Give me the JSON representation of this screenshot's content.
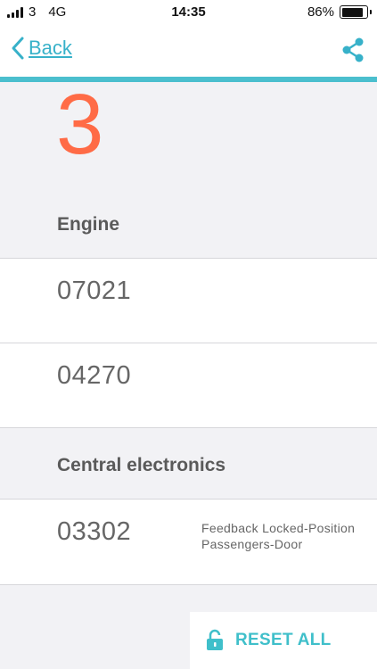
{
  "status_bar": {
    "carrier": "3",
    "network": "4G",
    "time": "14:35",
    "battery": "86%",
    "battery_level": 0.86
  },
  "nav": {
    "back_label": "Back",
    "share_icon": "share-icon",
    "accent_color": "#4bbfce"
  },
  "summary": {
    "count": "3",
    "count_color": "#ff6b46"
  },
  "sections": [
    {
      "title": "Engine",
      "codes": [
        {
          "code": "07021",
          "description": ""
        },
        {
          "code": "04270",
          "description": ""
        }
      ]
    },
    {
      "title": "Central electronics",
      "codes": [
        {
          "code": "03302",
          "description": "Feedback Locked-Position Passengers-Door"
        }
      ]
    }
  ],
  "actions": {
    "reset_label": "RESET ALL",
    "reset_icon": "unlock-icon",
    "reset_color": "#3fbfca"
  }
}
